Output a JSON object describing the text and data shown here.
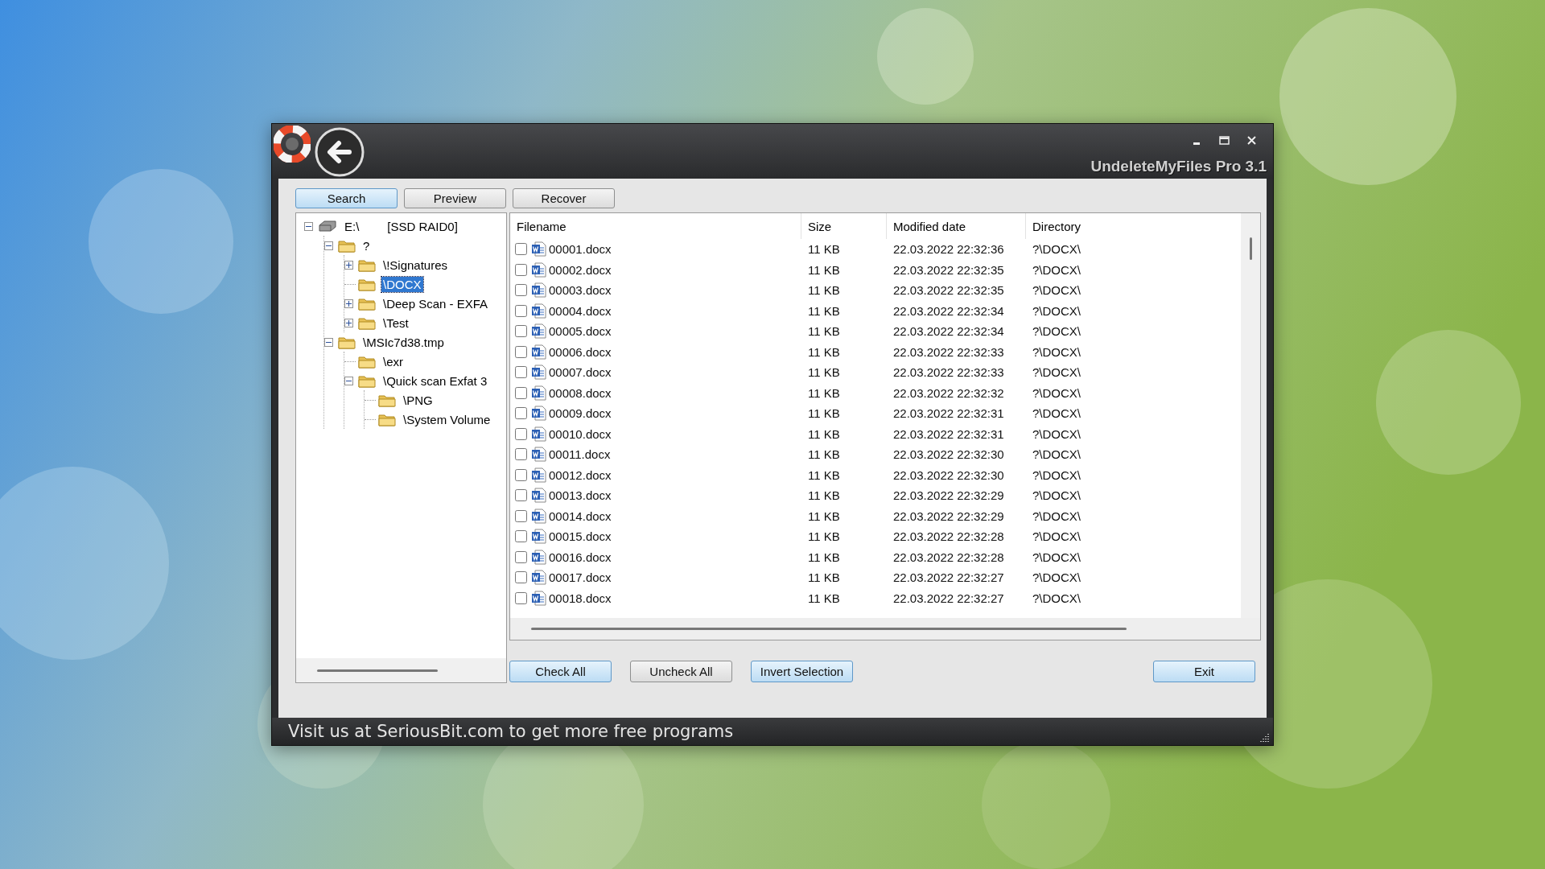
{
  "window": {
    "title": "UndeleteMyFiles Pro 3.1"
  },
  "tabs": [
    {
      "label": "Search",
      "selected": true
    },
    {
      "label": "Preview",
      "selected": false
    },
    {
      "label": "Recover",
      "selected": false
    }
  ],
  "tree": [
    {
      "label": "E:\\",
      "note": "[SSD RAID0]",
      "kind": "drive",
      "expanded": true,
      "selected": false,
      "children": [
        {
          "label": "?",
          "kind": "folder",
          "expanded": true,
          "selected": false,
          "children": [
            {
              "label": "\\!Signatures",
              "kind": "folder",
              "expanded": false,
              "selected": false
            },
            {
              "label": "\\DOCX",
              "kind": "folder",
              "selected": true
            },
            {
              "label": "\\Deep Scan - EXFA",
              "kind": "folder",
              "expanded": false,
              "selected": false
            },
            {
              "label": "\\Test",
              "kind": "folder",
              "expanded": false,
              "selected": false
            }
          ]
        },
        {
          "label": "\\MSIc7d38.tmp",
          "kind": "folder",
          "expanded": true,
          "selected": false,
          "children": [
            {
              "label": "\\exr",
              "kind": "folder",
              "selected": false
            },
            {
              "label": "\\Quick scan Exfat 3",
              "kind": "folder",
              "expanded": true,
              "selected": false,
              "children": [
                {
                  "label": "\\PNG",
                  "kind": "folder",
                  "selected": false
                },
                {
                  "label": "\\System Volume",
                  "kind": "folder",
                  "selected": false
                }
              ]
            }
          ]
        }
      ]
    }
  ],
  "table": {
    "columns": [
      "Filename",
      "Size",
      "Modified date",
      "Directory"
    ],
    "rows": [
      {
        "checked": false,
        "name": "00001.docx",
        "size": "11 KB",
        "modified": "22.03.2022 22:32:36",
        "directory": "?\\DOCX\\"
      },
      {
        "checked": false,
        "name": "00002.docx",
        "size": "11 KB",
        "modified": "22.03.2022 22:32:35",
        "directory": "?\\DOCX\\"
      },
      {
        "checked": false,
        "name": "00003.docx",
        "size": "11 KB",
        "modified": "22.03.2022 22:32:35",
        "directory": "?\\DOCX\\"
      },
      {
        "checked": false,
        "name": "00004.docx",
        "size": "11 KB",
        "modified": "22.03.2022 22:32:34",
        "directory": "?\\DOCX\\"
      },
      {
        "checked": false,
        "name": "00005.docx",
        "size": "11 KB",
        "modified": "22.03.2022 22:32:34",
        "directory": "?\\DOCX\\"
      },
      {
        "checked": false,
        "name": "00006.docx",
        "size": "11 KB",
        "modified": "22.03.2022 22:32:33",
        "directory": "?\\DOCX\\"
      },
      {
        "checked": false,
        "name": "00007.docx",
        "size": "11 KB",
        "modified": "22.03.2022 22:32:33",
        "directory": "?\\DOCX\\"
      },
      {
        "checked": false,
        "name": "00008.docx",
        "size": "11 KB",
        "modified": "22.03.2022 22:32:32",
        "directory": "?\\DOCX\\"
      },
      {
        "checked": false,
        "name": "00009.docx",
        "size": "11 KB",
        "modified": "22.03.2022 22:32:31",
        "directory": "?\\DOCX\\"
      },
      {
        "checked": false,
        "name": "00010.docx",
        "size": "11 KB",
        "modified": "22.03.2022 22:32:31",
        "directory": "?\\DOCX\\"
      },
      {
        "checked": false,
        "name": "00011.docx",
        "size": "11 KB",
        "modified": "22.03.2022 22:32:30",
        "directory": "?\\DOCX\\"
      },
      {
        "checked": false,
        "name": "00012.docx",
        "size": "11 KB",
        "modified": "22.03.2022 22:32:30",
        "directory": "?\\DOCX\\"
      },
      {
        "checked": false,
        "name": "00013.docx",
        "size": "11 KB",
        "modified": "22.03.2022 22:32:29",
        "directory": "?\\DOCX\\"
      },
      {
        "checked": false,
        "name": "00014.docx",
        "size": "11 KB",
        "modified": "22.03.2022 22:32:29",
        "directory": "?\\DOCX\\"
      },
      {
        "checked": false,
        "name": "00015.docx",
        "size": "11 KB",
        "modified": "22.03.2022 22:32:28",
        "directory": "?\\DOCX\\"
      },
      {
        "checked": false,
        "name": "00016.docx",
        "size": "11 KB",
        "modified": "22.03.2022 22:32:28",
        "directory": "?\\DOCX\\"
      },
      {
        "checked": false,
        "name": "00017.docx",
        "size": "11 KB",
        "modified": "22.03.2022 22:32:27",
        "directory": "?\\DOCX\\"
      },
      {
        "checked": false,
        "name": "00018.docx",
        "size": "11 KB",
        "modified": "22.03.2022 22:32:27",
        "directory": "?\\DOCX\\"
      }
    ]
  },
  "buttons": [
    "Check All",
    "Uncheck All",
    "Invert Selection"
  ],
  "exit_button": "Exit",
  "status_bar": "Visit us at SeriousBit.com to get more free programs"
}
